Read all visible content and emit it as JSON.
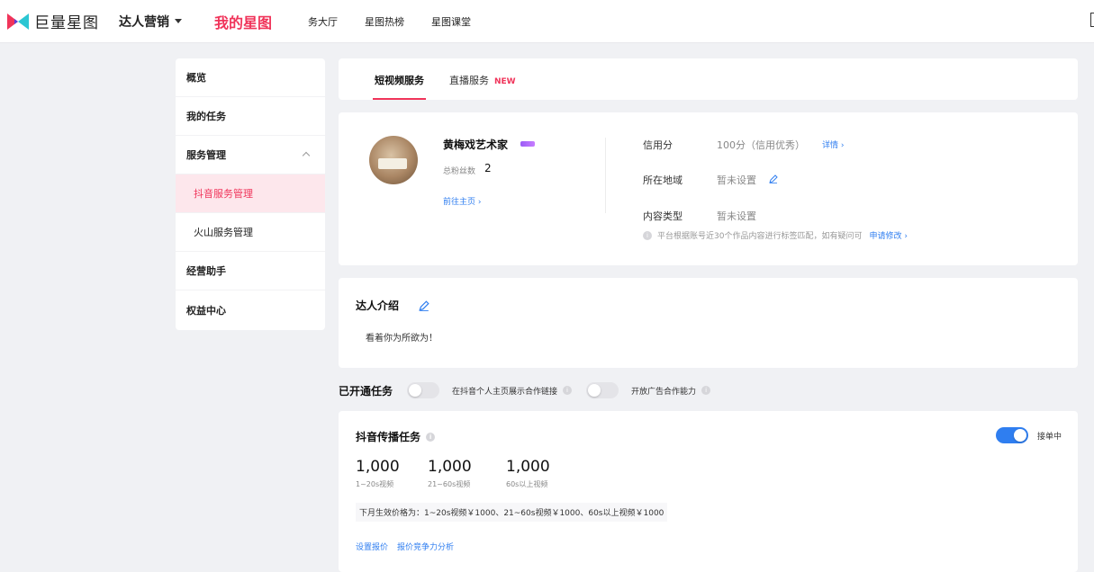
{
  "topnav": {
    "brand": "巨量星图",
    "role": "达人营销",
    "items": [
      "我的星图",
      "务大厅",
      "星图热榜",
      "星图课堂"
    ]
  },
  "sidebar": {
    "items": [
      {
        "label": "概览"
      },
      {
        "label": "我的任务"
      },
      {
        "label": "服务管理"
      },
      {
        "label": "抖音服务管理"
      },
      {
        "label": "火山服务管理"
      },
      {
        "label": "经营助手"
      },
      {
        "label": "权益中心"
      }
    ]
  },
  "tabs": {
    "short_video": "短视频服务",
    "live": "直播服务",
    "new_badge": "NEW"
  },
  "profile": {
    "name": "黄梅戏艺术家",
    "fans_label": "总粉丝数",
    "fans_value": "2",
    "homepage_link": "前往主页",
    "credit_label": "信用分",
    "credit_value": "100分（信用优秀）",
    "credit_link": "详情",
    "region_label": "所在地域",
    "region_value": "暂未设置",
    "content_label": "内容类型",
    "content_value": "暂未设置",
    "note": "平台根据账号近30个作品内容进行标签匹配，如有疑问可",
    "note_link": "申请修改"
  },
  "intro": {
    "title": "达人介绍",
    "text": "看着你为所欲为！"
  },
  "opened_tasks": {
    "title": "已开通任务",
    "toggle1_label": "在抖音个人主页展示合作链接",
    "toggle2_label": "开放广告合作能力"
  },
  "tasks": {
    "title": "抖音传播任务",
    "accept_label": "接单中",
    "prices": [
      {
        "value": "1,000",
        "label": "1~20s视频"
      },
      {
        "value": "1,000",
        "label": "21~60s视频"
      },
      {
        "value": "1,000",
        "label": "60s以上视频"
      }
    ],
    "next_month_note": "下月生效价格为：1~20s视频￥1000、21~60s视频￥1000、60s以上视频￥1000",
    "link_set_price": "设置报价",
    "link_analysis": "报价竞争力分析"
  },
  "colors": {
    "accent": "#f0345a",
    "link": "#2f7ef0"
  }
}
